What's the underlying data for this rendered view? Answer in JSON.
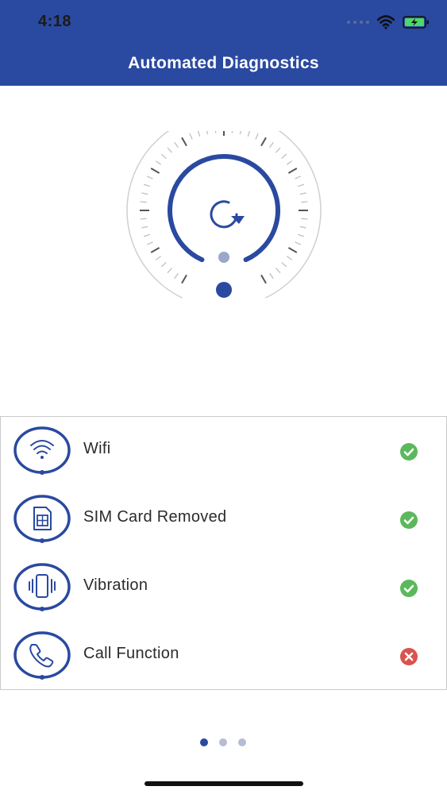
{
  "status_bar": {
    "time": "4:18"
  },
  "header": {
    "title": "Automated Diagnostics"
  },
  "colors": {
    "brand": "#2a49a0",
    "ok": "#5cb85c",
    "fail": "#d9534f"
  },
  "dial": {
    "center_icon": "refresh-icon"
  },
  "tests": [
    {
      "label": "Wifi",
      "icon": "wifi-icon",
      "status": "pass"
    },
    {
      "label": "SIM Card Removed",
      "icon": "sim-card-icon",
      "status": "pass"
    },
    {
      "label": "Vibration",
      "icon": "vibration-icon",
      "status": "pass"
    },
    {
      "label": "Call Function",
      "icon": "phone-icon",
      "status": "fail"
    }
  ],
  "pager": {
    "count": 3,
    "active_index": 0
  }
}
